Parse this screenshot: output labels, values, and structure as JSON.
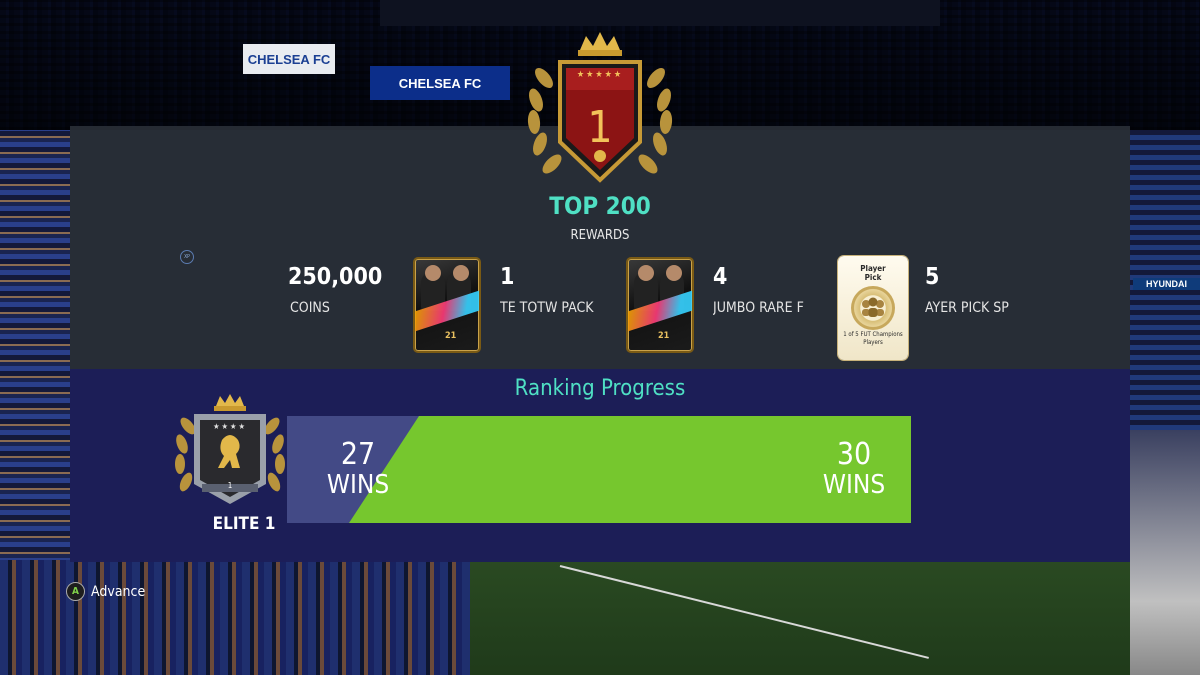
{
  "background": {
    "sign_left": "CHELSEA FC",
    "sign_center": "CHELSEA FC",
    "sign_right": "HYUNDAI"
  },
  "rank": {
    "number": "1",
    "tier": "TOP 200",
    "subtitle": "REWARDS",
    "stars": "★★★★★"
  },
  "rewards": [
    {
      "quantity": "250,000",
      "name": "COINS",
      "icon": "coins-icon"
    },
    {
      "quantity": "1",
      "name": "TE TOTW PACK",
      "icon": "pack-card-icon"
    },
    {
      "quantity": "4",
      "name": "JUMBO RARE F",
      "icon": "pack-card-icon"
    },
    {
      "quantity": "5",
      "name": "AYER PICK SP",
      "icon": "player-pick-card-icon"
    }
  ],
  "pack_rating": "21",
  "player_pick_card": {
    "title_line1": "Player",
    "title_line2": "Pick",
    "subtitle_line1": "1 of 5 FUT Champions",
    "subtitle_line2": "Players"
  },
  "progress": {
    "title": "Ranking Progress",
    "current_wins": "27",
    "target_wins": "30",
    "wins_label": "WINS",
    "fill_fraction": 0.9
  },
  "division": {
    "label": "ELITE 1",
    "stars": "★★★★",
    "number": "1"
  },
  "footer": {
    "advance_button": "A",
    "advance_label": "Advance"
  },
  "colors": {
    "accent": "#4fe0c4",
    "progress_fill": "#76c72e",
    "progress_track": "#434a86",
    "gold": "#f2c25a"
  }
}
